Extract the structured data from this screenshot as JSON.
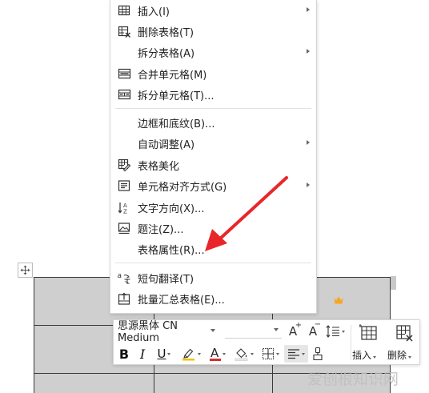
{
  "menu": {
    "items": [
      {
        "label": "插入(I)",
        "icon": "insert-table-icon",
        "submenu": true
      },
      {
        "label": "删除表格(T)",
        "icon": "delete-table-icon",
        "submenu": false
      },
      {
        "label": "拆分表格(A)",
        "icon": "",
        "submenu": true
      },
      {
        "label": "合并单元格(M)",
        "icon": "merge-cells-icon",
        "submenu": false
      },
      {
        "label": "拆分单元格(T)...",
        "icon": "split-cells-icon",
        "submenu": false
      },
      {
        "label": "边框和底纹(B)...",
        "icon": "",
        "submenu": false
      },
      {
        "label": "自动调整(A)",
        "icon": "",
        "submenu": true
      },
      {
        "label": "表格美化",
        "icon": "table-beautify-icon",
        "submenu": false
      },
      {
        "label": "单元格对齐方式(G)",
        "icon": "cell-align-icon",
        "submenu": true
      },
      {
        "label": "文字方向(X)...",
        "icon": "text-direction-icon",
        "submenu": false
      },
      {
        "label": "题注(Z)...",
        "icon": "caption-icon",
        "submenu": false
      },
      {
        "label": "表格属性(R)...",
        "icon": "",
        "submenu": false
      },
      {
        "label": "短句翻译(T)",
        "icon": "translate-icon",
        "submenu": false
      },
      {
        "label": "批量汇总表格(E)...",
        "icon": "batch-summary-icon",
        "submenu": false
      }
    ]
  },
  "toolbar": {
    "font_name": "思源黑体 CN Medium",
    "font_size": "",
    "bold": "B",
    "italic": "I",
    "underline": "U",
    "font_color_glyph": "A",
    "grow_glyph": "A",
    "shrink_glyph": "A",
    "insert_label": "插入",
    "delete_label": "删除"
  },
  "watermark": {
    "text": "爱创根知识网"
  },
  "colors": {
    "accent_red": "#e8262a",
    "font_color_underline": "#d03030",
    "highlight_underline": "#f2c200",
    "crown": "#f5a623"
  }
}
